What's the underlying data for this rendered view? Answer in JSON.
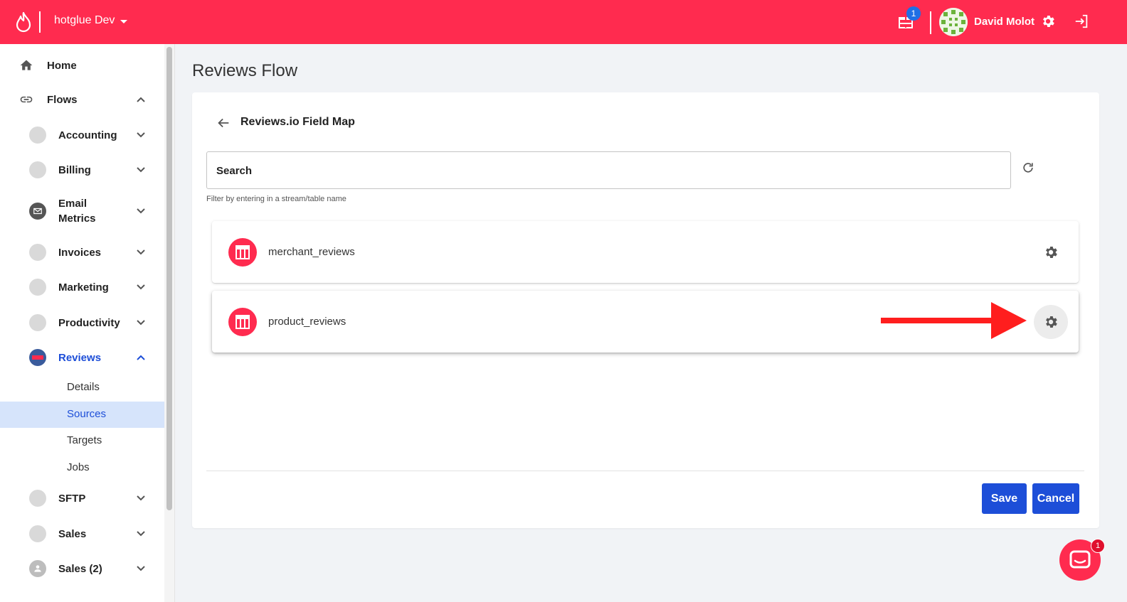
{
  "header": {
    "org_name": "hotglue Dev",
    "notification_count": "1",
    "user_name": "David Molot",
    "brand_color": "#ff2b4f"
  },
  "sidebar": {
    "home": "Home",
    "flows": "Flows",
    "items": [
      {
        "label": "Accounting",
        "icon": "accounting-icon"
      },
      {
        "label": "Billing",
        "icon": "billing-icon"
      },
      {
        "label": "Email Metrics",
        "icon": "email-icon"
      },
      {
        "label": "Invoices",
        "icon": "invoices-icon"
      },
      {
        "label": "Marketing",
        "icon": "marketing-icon"
      },
      {
        "label": "Productivity",
        "icon": "productivity-icon"
      },
      {
        "label": "Reviews",
        "icon": "reviews-icon",
        "active": true
      },
      {
        "label": "SFTP",
        "icon": "sftp-icon"
      },
      {
        "label": "Sales",
        "icon": "sales-icon"
      },
      {
        "label": "Sales (2)",
        "icon": "user-icon"
      }
    ],
    "reviews_children": [
      "Details",
      "Sources",
      "Targets",
      "Jobs"
    ],
    "active_child": "Sources",
    "active_color": "#1d4ed8"
  },
  "main": {
    "page_title": "Reviews Flow",
    "card_title": "Reviews.io Field Map",
    "search_placeholder": "Search",
    "helper_text": "Filter by entering in a stream/table name",
    "streams": [
      "merchant_reviews",
      "product_reviews"
    ],
    "save_label": "Save",
    "cancel_label": "Cancel",
    "button_color": "#1d4ed8"
  },
  "chat": {
    "badge_count": "1"
  }
}
